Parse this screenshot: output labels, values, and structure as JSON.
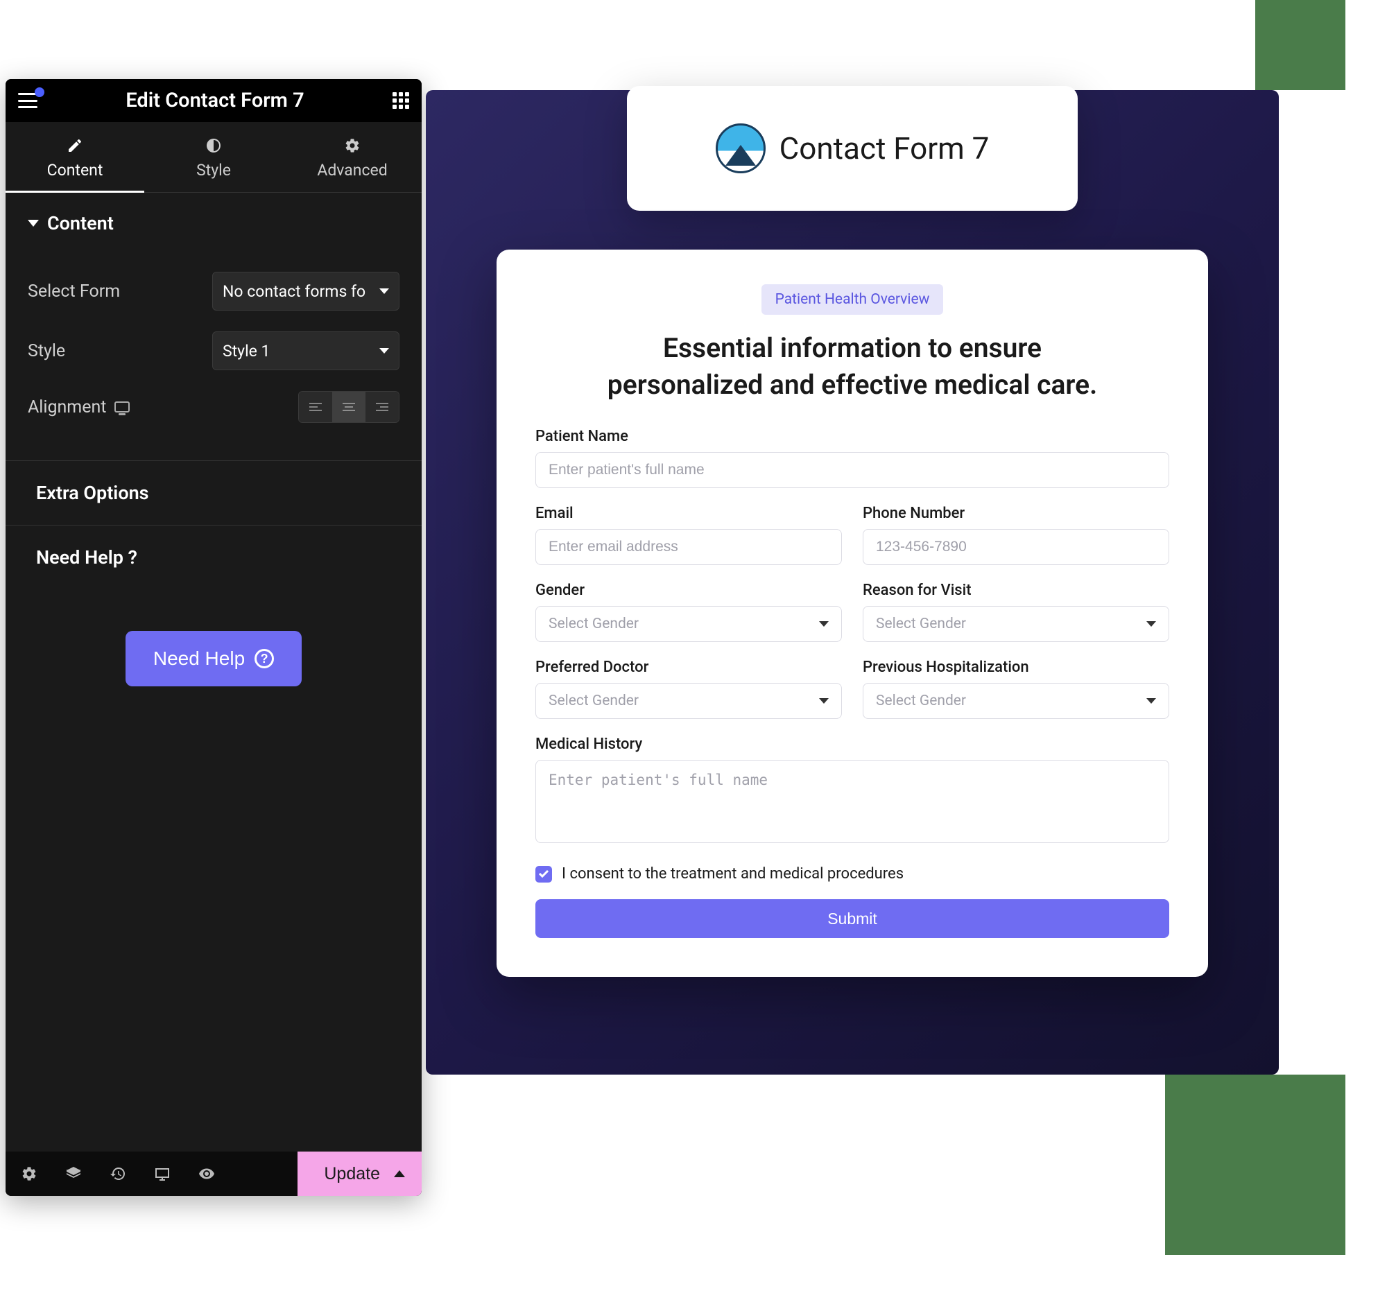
{
  "decorations": {
    "color": "#4a7c4a"
  },
  "editor": {
    "title": "Edit Contact Form 7",
    "tabs": {
      "content": "Content",
      "style": "Style",
      "advanced": "Advanced",
      "active": "content"
    },
    "section_content_label": "Content",
    "controls": {
      "select_form": {
        "label": "Select Form",
        "value": "No contact forms fo"
      },
      "style": {
        "label": "Style",
        "value": "Style 1"
      },
      "alignment": {
        "label": "Alignment",
        "selected": "center"
      }
    },
    "sections": {
      "extra_options": "Extra Options",
      "need_help": "Need Help ?"
    },
    "help_button": "Need Help",
    "footer": {
      "update": "Update"
    }
  },
  "preview": {
    "title_card": "Contact Form 7",
    "form": {
      "badge": "Patient Health Overview",
      "heading": "Essential information to ensure personalized and effective medical care.",
      "fields": {
        "patient_name": {
          "label": "Patient Name",
          "placeholder": "Enter patient's full name"
        },
        "email": {
          "label": "Email",
          "placeholder": "Enter email address"
        },
        "phone": {
          "label": "Phone Number",
          "placeholder": "123-456-7890"
        },
        "gender": {
          "label": "Gender",
          "placeholder": "Select Gender"
        },
        "reason": {
          "label": "Reason for Visit",
          "placeholder": "Select Gender"
        },
        "doctor": {
          "label": "Preferred Doctor",
          "placeholder": "Select Gender"
        },
        "hospitalization": {
          "label": "Previous Hospitalization",
          "placeholder": "Select Gender"
        },
        "history": {
          "label": "Medical History",
          "placeholder": "Enter patient's full name"
        }
      },
      "consent": {
        "text": "I consent to the treatment and medical procedures",
        "checked": true
      },
      "submit": "Submit"
    }
  }
}
